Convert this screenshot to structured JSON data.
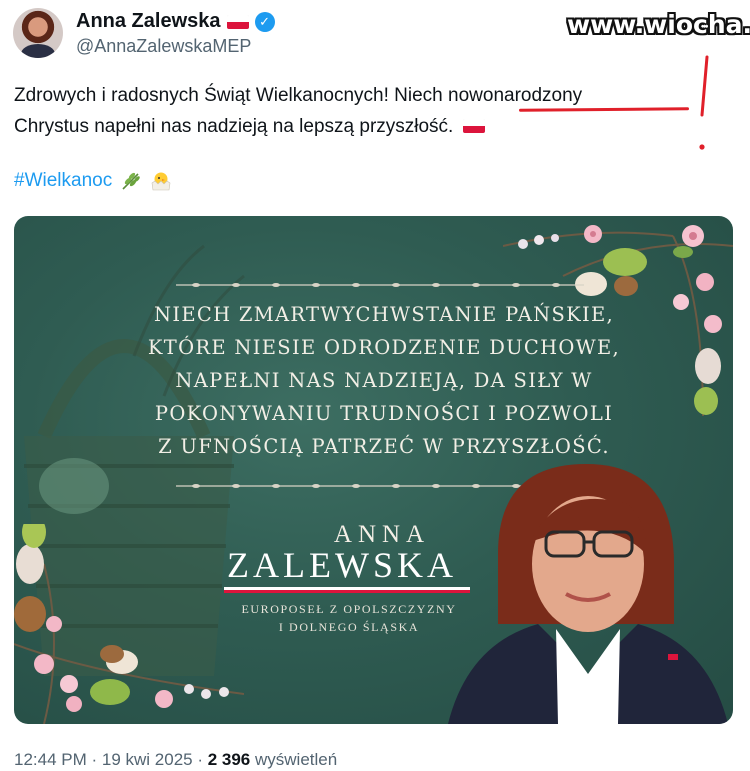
{
  "author": {
    "name": "Anna Zalewska",
    "handle": "@AnnaZalewskaMEP",
    "verified_badge_icon": "verified-check-icon",
    "flag_icon": "poland-flag-icon"
  },
  "watermark": "www.wiocha.pl",
  "tweet": {
    "line1_before": "Zdrowych i radosnych Świąt Wielkanocnych! Niech ",
    "line1_highlight": "nowonarodzony",
    "line2": "Chrystus napełni nas nadzieją na lepszą przyszłość.",
    "hashtag": "#Wielkanoc",
    "hashtag_icons": [
      "herb-icon",
      "hatching-chick-icon"
    ]
  },
  "card": {
    "greeting_lines": [
      "Niech Zmartwychwstanie Pańskie,",
      "które niesie odrodzenie duchowe,",
      "napełni nas nadzieją, da siły w",
      "pokonywaniu trudności i pozwoli",
      "z ufnością patrzeć w przyszłość."
    ],
    "first_name": "ANNA",
    "last_name": "ZALEWSKA",
    "subtitle_line1": "EUROPOSEŁ Z OPOLSZCZYZNY",
    "subtitle_line2": "I DOLNEGO ŚLĄSKA"
  },
  "meta": {
    "time": "12:44 PM",
    "separator": " · ",
    "date": "19 kwi 2025",
    "views_count": "2 396",
    "views_label": " wyświetleń"
  },
  "colors": {
    "accent": "#1d9bf0",
    "annotation_red": "#e0202a",
    "card_green": "#2f5c52",
    "flag_red": "#dc143c"
  }
}
